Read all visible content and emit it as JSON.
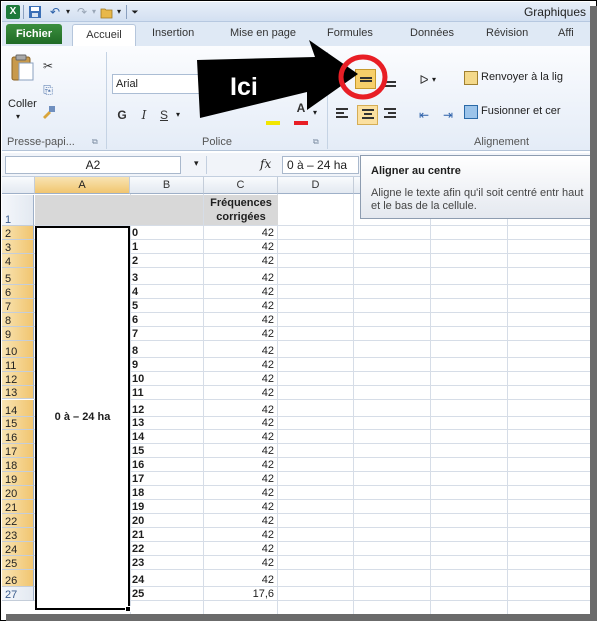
{
  "window": {
    "title": "Graphiques",
    "app_icon": "excel-icon"
  },
  "tabs": [
    {
      "label": "Fichier"
    },
    {
      "label": "Accueil"
    },
    {
      "label": "Insertion"
    },
    {
      "label": "Mise en page"
    },
    {
      "label": "Formules"
    },
    {
      "label": "Données"
    },
    {
      "label": "Révision"
    },
    {
      "label": "Affi"
    }
  ],
  "ribbon": {
    "clipboard": {
      "paste_label": "Coller",
      "group_label": "Presse-papi..."
    },
    "font": {
      "font_name": "Arial",
      "bold": "G",
      "italic": "I",
      "underline": "S",
      "group_label": "Police"
    },
    "alignment": {
      "wrap_label": "Renvoyer à la lig",
      "merge_label": "Fusionner et cer",
      "group_label": "Alignement"
    }
  },
  "tooltip": {
    "title": "Aligner au centre",
    "body": "Aligne le texte afin qu'il soit centré entr haut et le bas de la cellule."
  },
  "formula_bar": {
    "name_box": "A2",
    "fx": "fx",
    "content": "0 à – 24 ha"
  },
  "annotation": {
    "label": "Ici",
    "highlight_color": "#e81e25",
    "arrow_color": "#000000"
  },
  "sheet": {
    "columns": [
      "A",
      "B",
      "C",
      "D"
    ],
    "header_c": [
      "Fréquences",
      "corrigées"
    ],
    "merged_a": "0 à – 24 ha",
    "rows": [
      {
        "n": "1",
        "b": "",
        "c": ""
      },
      {
        "n": "2",
        "b": "0",
        "c": "42"
      },
      {
        "n": "3",
        "b": "1",
        "c": "42"
      },
      {
        "n": "4",
        "b": "2",
        "c": "42"
      },
      {
        "n": "5",
        "b": "3",
        "c": "42"
      },
      {
        "n": "6",
        "b": "4",
        "c": "42"
      },
      {
        "n": "7",
        "b": "5",
        "c": "42"
      },
      {
        "n": "8",
        "b": "6",
        "c": "42"
      },
      {
        "n": "9",
        "b": "7",
        "c": "42"
      },
      {
        "n": "10",
        "b": "8",
        "c": "42"
      },
      {
        "n": "11",
        "b": "9",
        "c": "42"
      },
      {
        "n": "12",
        "b": "10",
        "c": "42"
      },
      {
        "n": "13",
        "b": "11",
        "c": "42"
      },
      {
        "n": "14",
        "b": "12",
        "c": "42"
      },
      {
        "n": "15",
        "b": "13",
        "c": "42"
      },
      {
        "n": "16",
        "b": "14",
        "c": "42"
      },
      {
        "n": "17",
        "b": "15",
        "c": "42"
      },
      {
        "n": "18",
        "b": "16",
        "c": "42"
      },
      {
        "n": "19",
        "b": "17",
        "c": "42"
      },
      {
        "n": "20",
        "b": "18",
        "c": "42"
      },
      {
        "n": "21",
        "b": "19",
        "c": "42"
      },
      {
        "n": "22",
        "b": "20",
        "c": "42"
      },
      {
        "n": "23",
        "b": "21",
        "c": "42"
      },
      {
        "n": "24",
        "b": "22",
        "c": "42"
      },
      {
        "n": "25",
        "b": "23",
        "c": "42"
      },
      {
        "n": "26",
        "b": "24",
        "c": "42"
      },
      {
        "n": "27",
        "b": "25",
        "c": "17,6"
      }
    ]
  }
}
